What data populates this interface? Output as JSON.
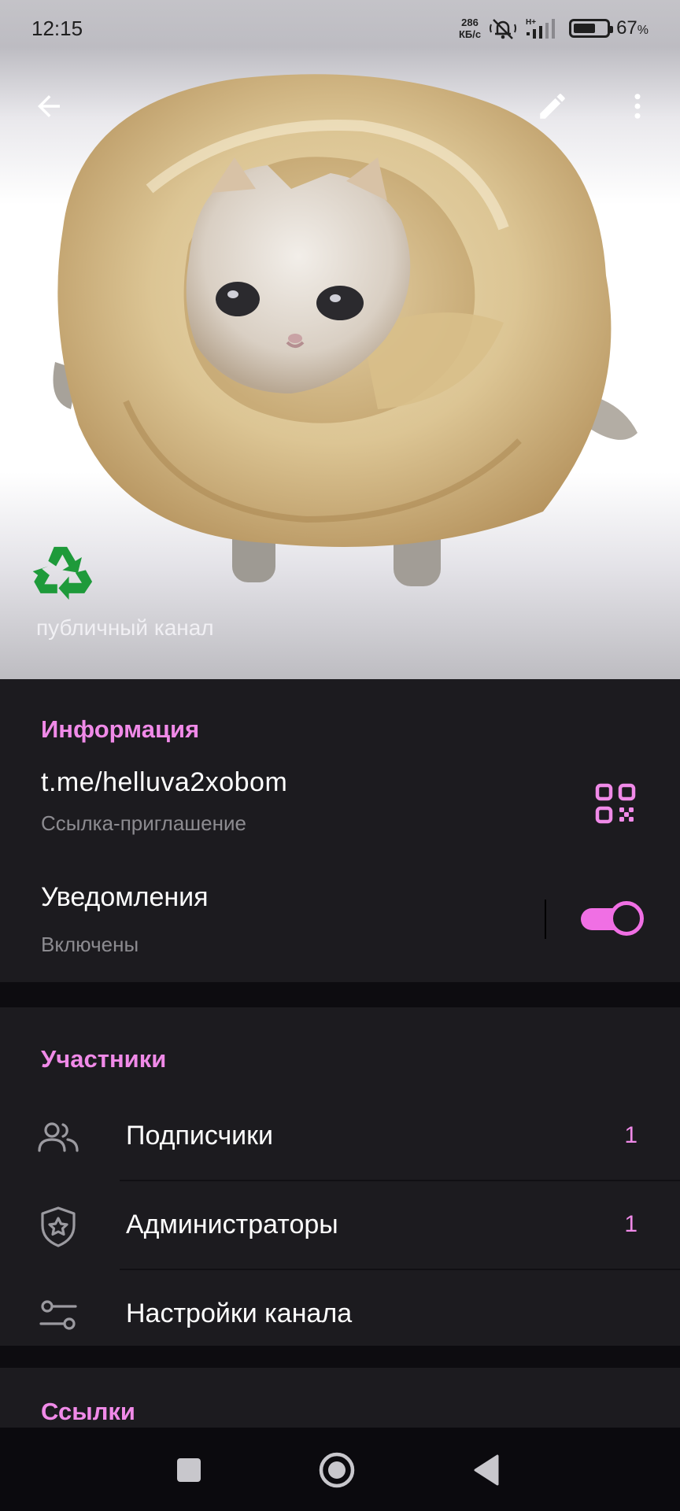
{
  "status_bar": {
    "time": "12:15",
    "speed_value": "286",
    "speed_unit": "КБ/с",
    "network": "H+",
    "battery": "67",
    "battery_unit": "%",
    "battery_level": 0.67
  },
  "header": {
    "channel_type": "публичный канал",
    "icons": [
      "back-arrow-icon",
      "pencil-icon",
      "more-vert-icon",
      "recycle-icon"
    ]
  },
  "info": {
    "title": "Информация",
    "link": "t.me/helluva2xobom",
    "link_caption": "Ссылка-приглашение",
    "notifications_title": "Уведомления",
    "notifications_status": "Включены",
    "notifications_enabled": true
  },
  "members": {
    "title": "Участники",
    "items": [
      {
        "label": "Подписчики",
        "count": "1",
        "icon": "people-icon"
      },
      {
        "label": "Администраторы",
        "count": "1",
        "icon": "shield-star-icon"
      },
      {
        "label": "Настройки канала",
        "count": "",
        "icon": "sliders-icon"
      }
    ]
  },
  "links": {
    "title": "Ссылки"
  },
  "colors": {
    "accent": "#f08ae8",
    "background": "#1c1b1f",
    "secondary_text": "#8c8b90"
  }
}
